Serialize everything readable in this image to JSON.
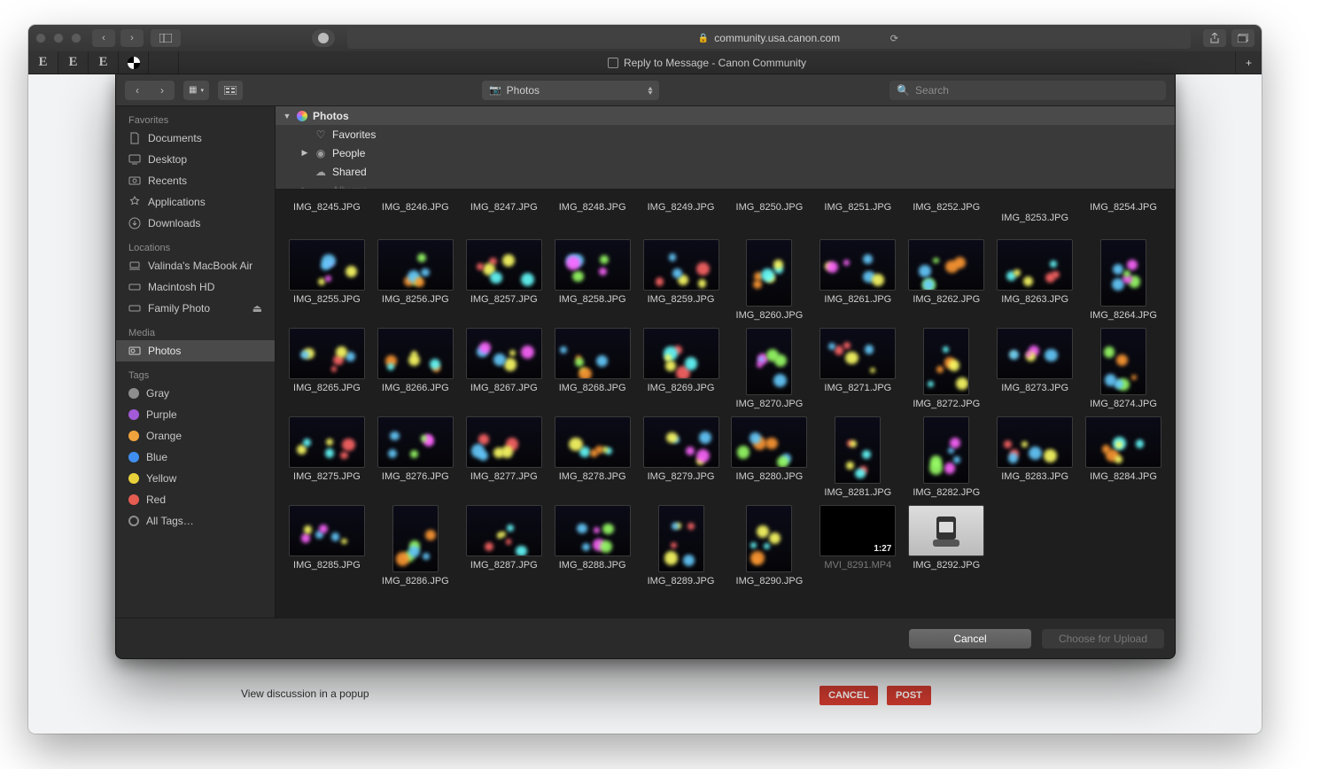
{
  "browser": {
    "url_host": "community.usa.canon.com",
    "tab_title": "Reply to Message - Canon Community",
    "fav_tabs": [
      "E",
      "E",
      "E"
    ]
  },
  "page": {
    "discussion_link": "View discussion in a popup",
    "cancel": "CANCEL",
    "post": "POST"
  },
  "dialog": {
    "path_label": "Photos",
    "search_placeholder": "Search",
    "cancel": "Cancel",
    "choose": "Choose for Upload",
    "sidebar": {
      "favorites_title": "Favorites",
      "favorites": [
        "Documents",
        "Desktop",
        "Recents",
        "Applications",
        "Downloads"
      ],
      "locations_title": "Locations",
      "locations": [
        "Valinda's MacBook Air",
        "Macintosh HD",
        "Family Photo"
      ],
      "media_title": "Media",
      "media": [
        "Photos"
      ],
      "tags_title": "Tags",
      "tags": [
        {
          "label": "Gray",
          "color": "#8e8e8e"
        },
        {
          "label": "Purple",
          "color": "#a25ad8"
        },
        {
          "label": "Orange",
          "color": "#f0a33c"
        },
        {
          "label": "Blue",
          "color": "#3f8ef0"
        },
        {
          "label": "Yellow",
          "color": "#e8d13a"
        },
        {
          "label": "Red",
          "color": "#e55c51"
        }
      ],
      "all_tags": "All Tags…"
    },
    "tree": {
      "root": "Photos",
      "children": [
        "Favorites",
        "People",
        "Shared",
        "Albums"
      ]
    },
    "files_row_top": [
      "IMG_8245.JPG",
      "IMG_8246.JPG",
      "IMG_8247.JPG",
      "IMG_8248.JPG",
      "IMG_8249.JPG",
      "IMG_8250.JPG",
      "IMG_8251.JPG",
      "IMG_8252.JPG",
      "IMG_8253.JPG",
      "IMG_8254.JPG"
    ],
    "files": [
      {
        "n": "IMG_8255.JPG"
      },
      {
        "n": "IMG_8256.JPG"
      },
      {
        "n": "IMG_8257.JPG"
      },
      {
        "n": "IMG_8258.JPG"
      },
      {
        "n": "IMG_8259.JPG"
      },
      {
        "n": "IMG_8260.JPG",
        "tall": true
      },
      {
        "n": "IMG_8261.JPG"
      },
      {
        "n": "IMG_8262.JPG"
      },
      {
        "n": "IMG_8263.JPG"
      },
      {
        "n": "IMG_8264.JPG",
        "tall": true
      },
      {
        "n": "IMG_8265.JPG"
      },
      {
        "n": "IMG_8266.JPG"
      },
      {
        "n": "IMG_8267.JPG"
      },
      {
        "n": "IMG_8268.JPG"
      },
      {
        "n": "IMG_8269.JPG"
      },
      {
        "n": "IMG_8270.JPG",
        "tall": true
      },
      {
        "n": "IMG_8271.JPG"
      },
      {
        "n": "IMG_8272.JPG",
        "tall": true
      },
      {
        "n": "IMG_8273.JPG"
      },
      {
        "n": "IMG_8274.JPG",
        "tall": true
      },
      {
        "n": "IMG_8275.JPG"
      },
      {
        "n": "IMG_8276.JPG"
      },
      {
        "n": "IMG_8277.JPG"
      },
      {
        "n": "IMG_8278.JPG"
      },
      {
        "n": "IMG_8279.JPG"
      },
      {
        "n": "IMG_8280.JPG"
      },
      {
        "n": "IMG_8281.JPG",
        "tall": true
      },
      {
        "n": "IMG_8282.JPG",
        "tall": true
      },
      {
        "n": "IMG_8283.JPG"
      },
      {
        "n": "IMG_8284.JPG"
      },
      {
        "n": "IMG_8285.JPG"
      },
      {
        "n": "IMG_8286.JPG",
        "tall": true
      },
      {
        "n": "IMG_8287.JPG"
      },
      {
        "n": "IMG_8288.JPG"
      },
      {
        "n": "IMG_8289.JPG",
        "tall": true
      },
      {
        "n": "IMG_8290.JPG",
        "tall": true
      },
      {
        "n": "MVI_8291.MP4",
        "video": true,
        "dur": "1:27"
      },
      {
        "n": "IMG_8292.JPG",
        "camera": true
      }
    ]
  }
}
